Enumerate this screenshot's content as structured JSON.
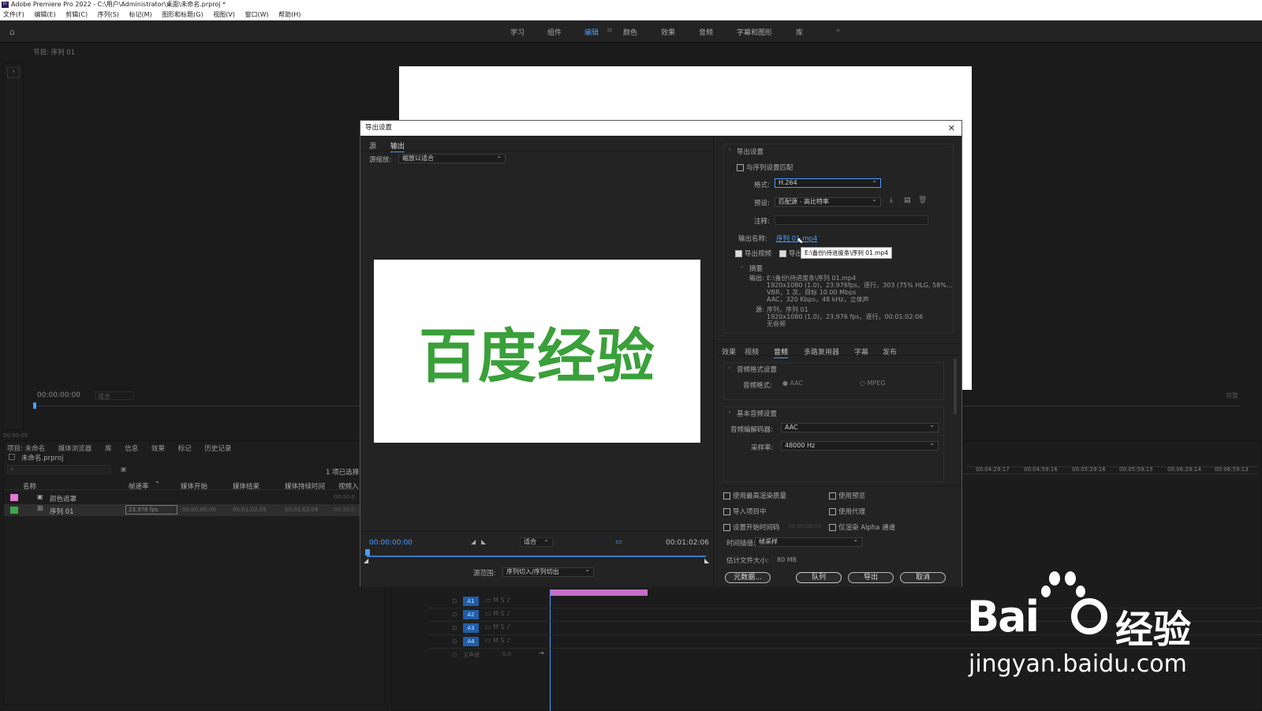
{
  "window": {
    "title": "Adobe Premiere Pro 2022 - C:\\用户\\Administrator\\桌面\\未命名.prproj *",
    "app_badge": "Pr"
  },
  "menu": [
    "文件(F)",
    "编辑(E)",
    "剪辑(C)",
    "序列(S)",
    "标记(M)",
    "图形和标题(G)",
    "视图(V)",
    "窗口(W)",
    "帮助(H)"
  ],
  "workspaces": [
    "学习",
    "组件",
    "编辑",
    "颜色",
    "效果",
    "音频",
    "字幕和图形",
    "库"
  ],
  "workspace_active": "编辑",
  "left_monitor": {
    "tab": "节目: 序列 01",
    "timecode": "00:00:00:00",
    "fit": "适合",
    "corner_tc": "00:00:00"
  },
  "project": {
    "tabs": [
      "项目: 未命名",
      "媒体浏览器",
      "库",
      "信息",
      "效果",
      "标记",
      "历史记录"
    ],
    "file": "未命名.prproj",
    "selected_count": "1 项已选择",
    "columns": [
      "名称",
      "帧速率",
      "媒体开始",
      "媒体结束",
      "媒体持续时间",
      "视频入"
    ],
    "rows": [
      {
        "name": "颜色遮罩",
        "color": "#e07ad2",
        "fps": "",
        "start": "",
        "end": "",
        "duration": "",
        "in": "00:00:0"
      },
      {
        "name": "序列 01",
        "color": "#3ea84a",
        "fps": "23.976 fps",
        "start": "00:00:00:00",
        "end": "00:01:02:05",
        "duration": "00:01:02:06",
        "in": "00:00:0"
      }
    ]
  },
  "timeline": {
    "ruler": [
      "00:04:29:17",
      "00:04:59:16",
      "00:05:29:16",
      "00:05:59:15",
      "00:06:29:14",
      "00:06:59:13"
    ],
    "tracks": [
      "A1",
      "A2",
      "A3",
      "A4"
    ],
    "master": "主声道",
    "master_value": "0.0",
    "right_label": "完整"
  },
  "dialog": {
    "title": "导出设置",
    "left_tabs": [
      "源",
      "输出"
    ],
    "left_tab_active": "输出",
    "source_scale_label": "源缩放:",
    "source_scale_value": "缩放以适合",
    "preview_text": "百度经验",
    "preview_color": "#3aa03a",
    "timecode_in": "00:00:00:00",
    "fit_value": "适合",
    "timecode_out": "00:01:02:06",
    "source_range_label": "源范围:",
    "source_range_value": "序列切入/序列切出",
    "export_settings": {
      "section": "导出设置",
      "match_sequence": "与序列设置匹配",
      "format_label": "格式:",
      "format_value": "H.264",
      "preset_label": "预设:",
      "preset_value": "匹配源 - 高比特率",
      "comment_label": "注释:",
      "output_name_label": "输出名称:",
      "output_name_value": "序列 01.mp4",
      "export_video": "导出视频",
      "export_audio": "导出",
      "tooltip": "E:\\备份\\待进度条\\序列 01.mp4"
    },
    "summary": {
      "section": "摘要",
      "output_label": "输出:",
      "output_lines": [
        "E:\\备份\\待进度条\\序列 01.mp4",
        "1920x1080 (1.0)，23.976fps，逐行，303 (75% HLG, 58%...",
        "VBR，1 次，目标 10.00 Mbps",
        "AAC，320 Kbps，48 kHz，立体声"
      ],
      "source_label": "源:",
      "source_lines": [
        "序列，序列 01",
        "1920x1080 (1.0)，23.976 fps，逐行，00:01:02:06",
        "无音频"
      ]
    },
    "right_tabs": [
      "效果",
      "视频",
      "音频",
      "多路复用器",
      "字幕",
      "发布"
    ],
    "right_tab_active": "音频",
    "audio_format": {
      "section": "音频格式设置",
      "label": "音频格式:",
      "option_aac": "AAC",
      "option_mpeg": "MPEG"
    },
    "basic_audio": {
      "section": "基本音频设置",
      "codec_label": "音频编解码器:",
      "codec_value": "AAC",
      "sample_label": "采样率:",
      "sample_value": "48000 Hz"
    },
    "options": {
      "max_render": "使用最高渲染质量",
      "use_preview": "使用预览",
      "import_project": "导入项目中",
      "use_proxy": "使用代理",
      "set_start_tc": "设置开始时间码",
      "start_tc_value": "00:00:00:00",
      "alpha_only": "仅渲染 Alpha 通道",
      "interp_label": "时间插值:",
      "interp_value": "帧采样",
      "filesize_label": "估计文件大小:",
      "filesize_value": "80 MB"
    },
    "buttons": {
      "metadata": "元数据...",
      "queue": "队列",
      "export": "导出",
      "cancel": "取消"
    }
  },
  "watermark": {
    "brand": "Bai",
    "brand_cn": "经验",
    "url": "jingyan.baidu.com"
  }
}
